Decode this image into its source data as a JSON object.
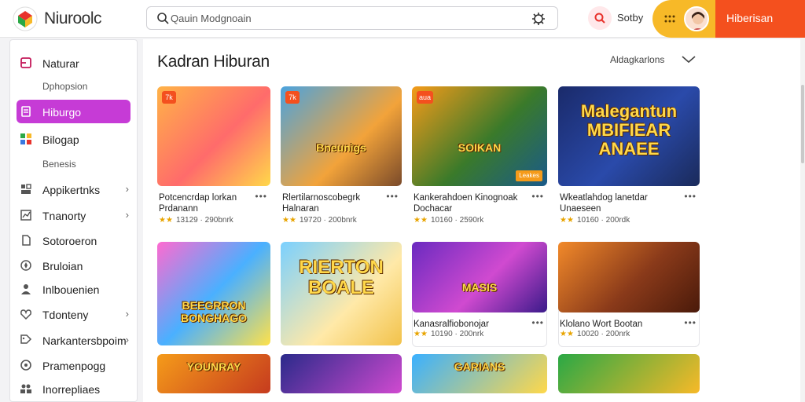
{
  "app": {
    "title": "Niuroolc"
  },
  "search": {
    "text": "Qauin Modgnoain"
  },
  "header": {
    "user_name": "Sotby",
    "cta_label": "Hiberisan"
  },
  "colors": {
    "accent": "#c63bd6",
    "cta": "#f4501e",
    "chip": "#f7b928"
  },
  "sidebar": {
    "items": [
      {
        "label": "Naturar",
        "icon": "square-icon",
        "chevron": ""
      },
      {
        "label": "Hiburgo",
        "icon": "book-icon",
        "chevron": ""
      },
      {
        "label": "Bilogap",
        "icon": "grid-icon",
        "chevron": ""
      },
      {
        "label": "Appikertnks",
        "icon": "apps-icon",
        "chevron": "›"
      },
      {
        "label": "Tnanorty",
        "icon": "chart-icon",
        "chevron": "›"
      },
      {
        "label": "Sotoroeron",
        "icon": "file-icon",
        "chevron": ""
      },
      {
        "label": "Bruloian",
        "icon": "compass-icon",
        "chevron": ""
      },
      {
        "label": "Inlbouenien",
        "icon": "user-icon",
        "chevron": ""
      },
      {
        "label": "Tdonteny",
        "icon": "heart-icon",
        "chevron": "›"
      },
      {
        "label": "Narkantersbpoim",
        "icon": "tag-icon",
        "chevron": "›"
      },
      {
        "label": "Pramenpogg",
        "icon": "circle-icon",
        "chevron": ""
      },
      {
        "label": "Inorrepliaes",
        "icon": "people-icon",
        "chevron": ""
      }
    ],
    "subs": [
      "Dphopsion",
      "Benesis"
    ]
  },
  "main": {
    "section_title": "Kadran Hiburan",
    "sort_label": "Aldagkarlons",
    "cards": [
      {
        "title": "Potcencrdap lorkan Prdanann",
        "rating": "★★",
        "meta": "13129 · 290bnrk",
        "badge": "7k",
        "art_text": "",
        "tag": ""
      },
      {
        "title": "Rlertilarnoscobegrk Halnaran",
        "rating": "★★",
        "meta": "19720 · 200bnrk",
        "badge": "7k",
        "art_text": "Bneunigs",
        "tag": ""
      },
      {
        "title": "Kankerahdoen Kinognoak Dochacar",
        "rating": "★★",
        "meta": "10160 · 2590rk",
        "badge": "aua",
        "art_text": "SOIKAN",
        "tag": "Leakes"
      },
      {
        "title": "Wkeatlahdog lanetdar Unaeseen",
        "rating": "★★",
        "meta": "10160 · 200rdk",
        "badge": "",
        "art_text": "Malegantun MBIFIEAR ANAEE",
        "tag": ""
      },
      {
        "title": "",
        "rating": "",
        "meta": "",
        "badge": "",
        "art_text": "BEEGRRON BONGHAGO",
        "tag": ""
      },
      {
        "title": "",
        "rating": "",
        "meta": "",
        "badge": "",
        "art_text": "RIERTON BOALE",
        "tag": ""
      },
      {
        "title": "Kanasralfiobonojar",
        "rating": "★★",
        "meta": "10190 · 200nrk",
        "badge": "",
        "art_text": "MASIS",
        "tag": ""
      },
      {
        "title": "Klolano Wort Bootan",
        "rating": "★★",
        "meta": "10020 · 200nrk",
        "badge": "",
        "art_text": "",
        "tag": ""
      },
      {
        "title": "",
        "rating": "",
        "meta": "",
        "badge": "",
        "art_text": "YOUNRAY",
        "tag": ""
      },
      {
        "title": "",
        "rating": "",
        "meta": "",
        "badge": "",
        "art_text": "",
        "tag": ""
      },
      {
        "title": "",
        "rating": "",
        "meta": "",
        "badge": "",
        "art_text": "GARIANS",
        "tag": ""
      },
      {
        "title": "",
        "rating": "",
        "meta": "",
        "badge": "",
        "art_text": "",
        "tag": ""
      }
    ]
  }
}
